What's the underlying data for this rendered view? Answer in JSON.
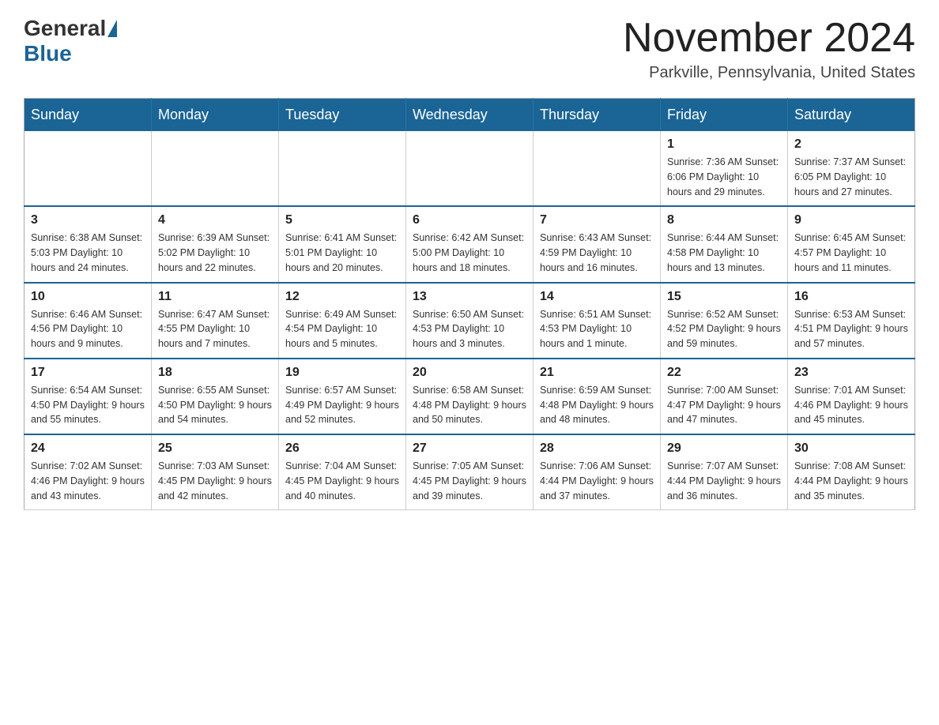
{
  "header": {
    "logo_general": "General",
    "logo_blue": "Blue",
    "title": "November 2024",
    "location": "Parkville, Pennsylvania, United States"
  },
  "calendar": {
    "days_of_week": [
      "Sunday",
      "Monday",
      "Tuesday",
      "Wednesday",
      "Thursday",
      "Friday",
      "Saturday"
    ],
    "weeks": [
      [
        {
          "day": "",
          "info": ""
        },
        {
          "day": "",
          "info": ""
        },
        {
          "day": "",
          "info": ""
        },
        {
          "day": "",
          "info": ""
        },
        {
          "day": "",
          "info": ""
        },
        {
          "day": "1",
          "info": "Sunrise: 7:36 AM\nSunset: 6:06 PM\nDaylight: 10 hours and 29 minutes."
        },
        {
          "day": "2",
          "info": "Sunrise: 7:37 AM\nSunset: 6:05 PM\nDaylight: 10 hours and 27 minutes."
        }
      ],
      [
        {
          "day": "3",
          "info": "Sunrise: 6:38 AM\nSunset: 5:03 PM\nDaylight: 10 hours and 24 minutes."
        },
        {
          "day": "4",
          "info": "Sunrise: 6:39 AM\nSunset: 5:02 PM\nDaylight: 10 hours and 22 minutes."
        },
        {
          "day": "5",
          "info": "Sunrise: 6:41 AM\nSunset: 5:01 PM\nDaylight: 10 hours and 20 minutes."
        },
        {
          "day": "6",
          "info": "Sunrise: 6:42 AM\nSunset: 5:00 PM\nDaylight: 10 hours and 18 minutes."
        },
        {
          "day": "7",
          "info": "Sunrise: 6:43 AM\nSunset: 4:59 PM\nDaylight: 10 hours and 16 minutes."
        },
        {
          "day": "8",
          "info": "Sunrise: 6:44 AM\nSunset: 4:58 PM\nDaylight: 10 hours and 13 minutes."
        },
        {
          "day": "9",
          "info": "Sunrise: 6:45 AM\nSunset: 4:57 PM\nDaylight: 10 hours and 11 minutes."
        }
      ],
      [
        {
          "day": "10",
          "info": "Sunrise: 6:46 AM\nSunset: 4:56 PM\nDaylight: 10 hours and 9 minutes."
        },
        {
          "day": "11",
          "info": "Sunrise: 6:47 AM\nSunset: 4:55 PM\nDaylight: 10 hours and 7 minutes."
        },
        {
          "day": "12",
          "info": "Sunrise: 6:49 AM\nSunset: 4:54 PM\nDaylight: 10 hours and 5 minutes."
        },
        {
          "day": "13",
          "info": "Sunrise: 6:50 AM\nSunset: 4:53 PM\nDaylight: 10 hours and 3 minutes."
        },
        {
          "day": "14",
          "info": "Sunrise: 6:51 AM\nSunset: 4:53 PM\nDaylight: 10 hours and 1 minute."
        },
        {
          "day": "15",
          "info": "Sunrise: 6:52 AM\nSunset: 4:52 PM\nDaylight: 9 hours and 59 minutes."
        },
        {
          "day": "16",
          "info": "Sunrise: 6:53 AM\nSunset: 4:51 PM\nDaylight: 9 hours and 57 minutes."
        }
      ],
      [
        {
          "day": "17",
          "info": "Sunrise: 6:54 AM\nSunset: 4:50 PM\nDaylight: 9 hours and 55 minutes."
        },
        {
          "day": "18",
          "info": "Sunrise: 6:55 AM\nSunset: 4:50 PM\nDaylight: 9 hours and 54 minutes."
        },
        {
          "day": "19",
          "info": "Sunrise: 6:57 AM\nSunset: 4:49 PM\nDaylight: 9 hours and 52 minutes."
        },
        {
          "day": "20",
          "info": "Sunrise: 6:58 AM\nSunset: 4:48 PM\nDaylight: 9 hours and 50 minutes."
        },
        {
          "day": "21",
          "info": "Sunrise: 6:59 AM\nSunset: 4:48 PM\nDaylight: 9 hours and 48 minutes."
        },
        {
          "day": "22",
          "info": "Sunrise: 7:00 AM\nSunset: 4:47 PM\nDaylight: 9 hours and 47 minutes."
        },
        {
          "day": "23",
          "info": "Sunrise: 7:01 AM\nSunset: 4:46 PM\nDaylight: 9 hours and 45 minutes."
        }
      ],
      [
        {
          "day": "24",
          "info": "Sunrise: 7:02 AM\nSunset: 4:46 PM\nDaylight: 9 hours and 43 minutes."
        },
        {
          "day": "25",
          "info": "Sunrise: 7:03 AM\nSunset: 4:45 PM\nDaylight: 9 hours and 42 minutes."
        },
        {
          "day": "26",
          "info": "Sunrise: 7:04 AM\nSunset: 4:45 PM\nDaylight: 9 hours and 40 minutes."
        },
        {
          "day": "27",
          "info": "Sunrise: 7:05 AM\nSunset: 4:45 PM\nDaylight: 9 hours and 39 minutes."
        },
        {
          "day": "28",
          "info": "Sunrise: 7:06 AM\nSunset: 4:44 PM\nDaylight: 9 hours and 37 minutes."
        },
        {
          "day": "29",
          "info": "Sunrise: 7:07 AM\nSunset: 4:44 PM\nDaylight: 9 hours and 36 minutes."
        },
        {
          "day": "30",
          "info": "Sunrise: 7:08 AM\nSunset: 4:44 PM\nDaylight: 9 hours and 35 minutes."
        }
      ]
    ]
  }
}
